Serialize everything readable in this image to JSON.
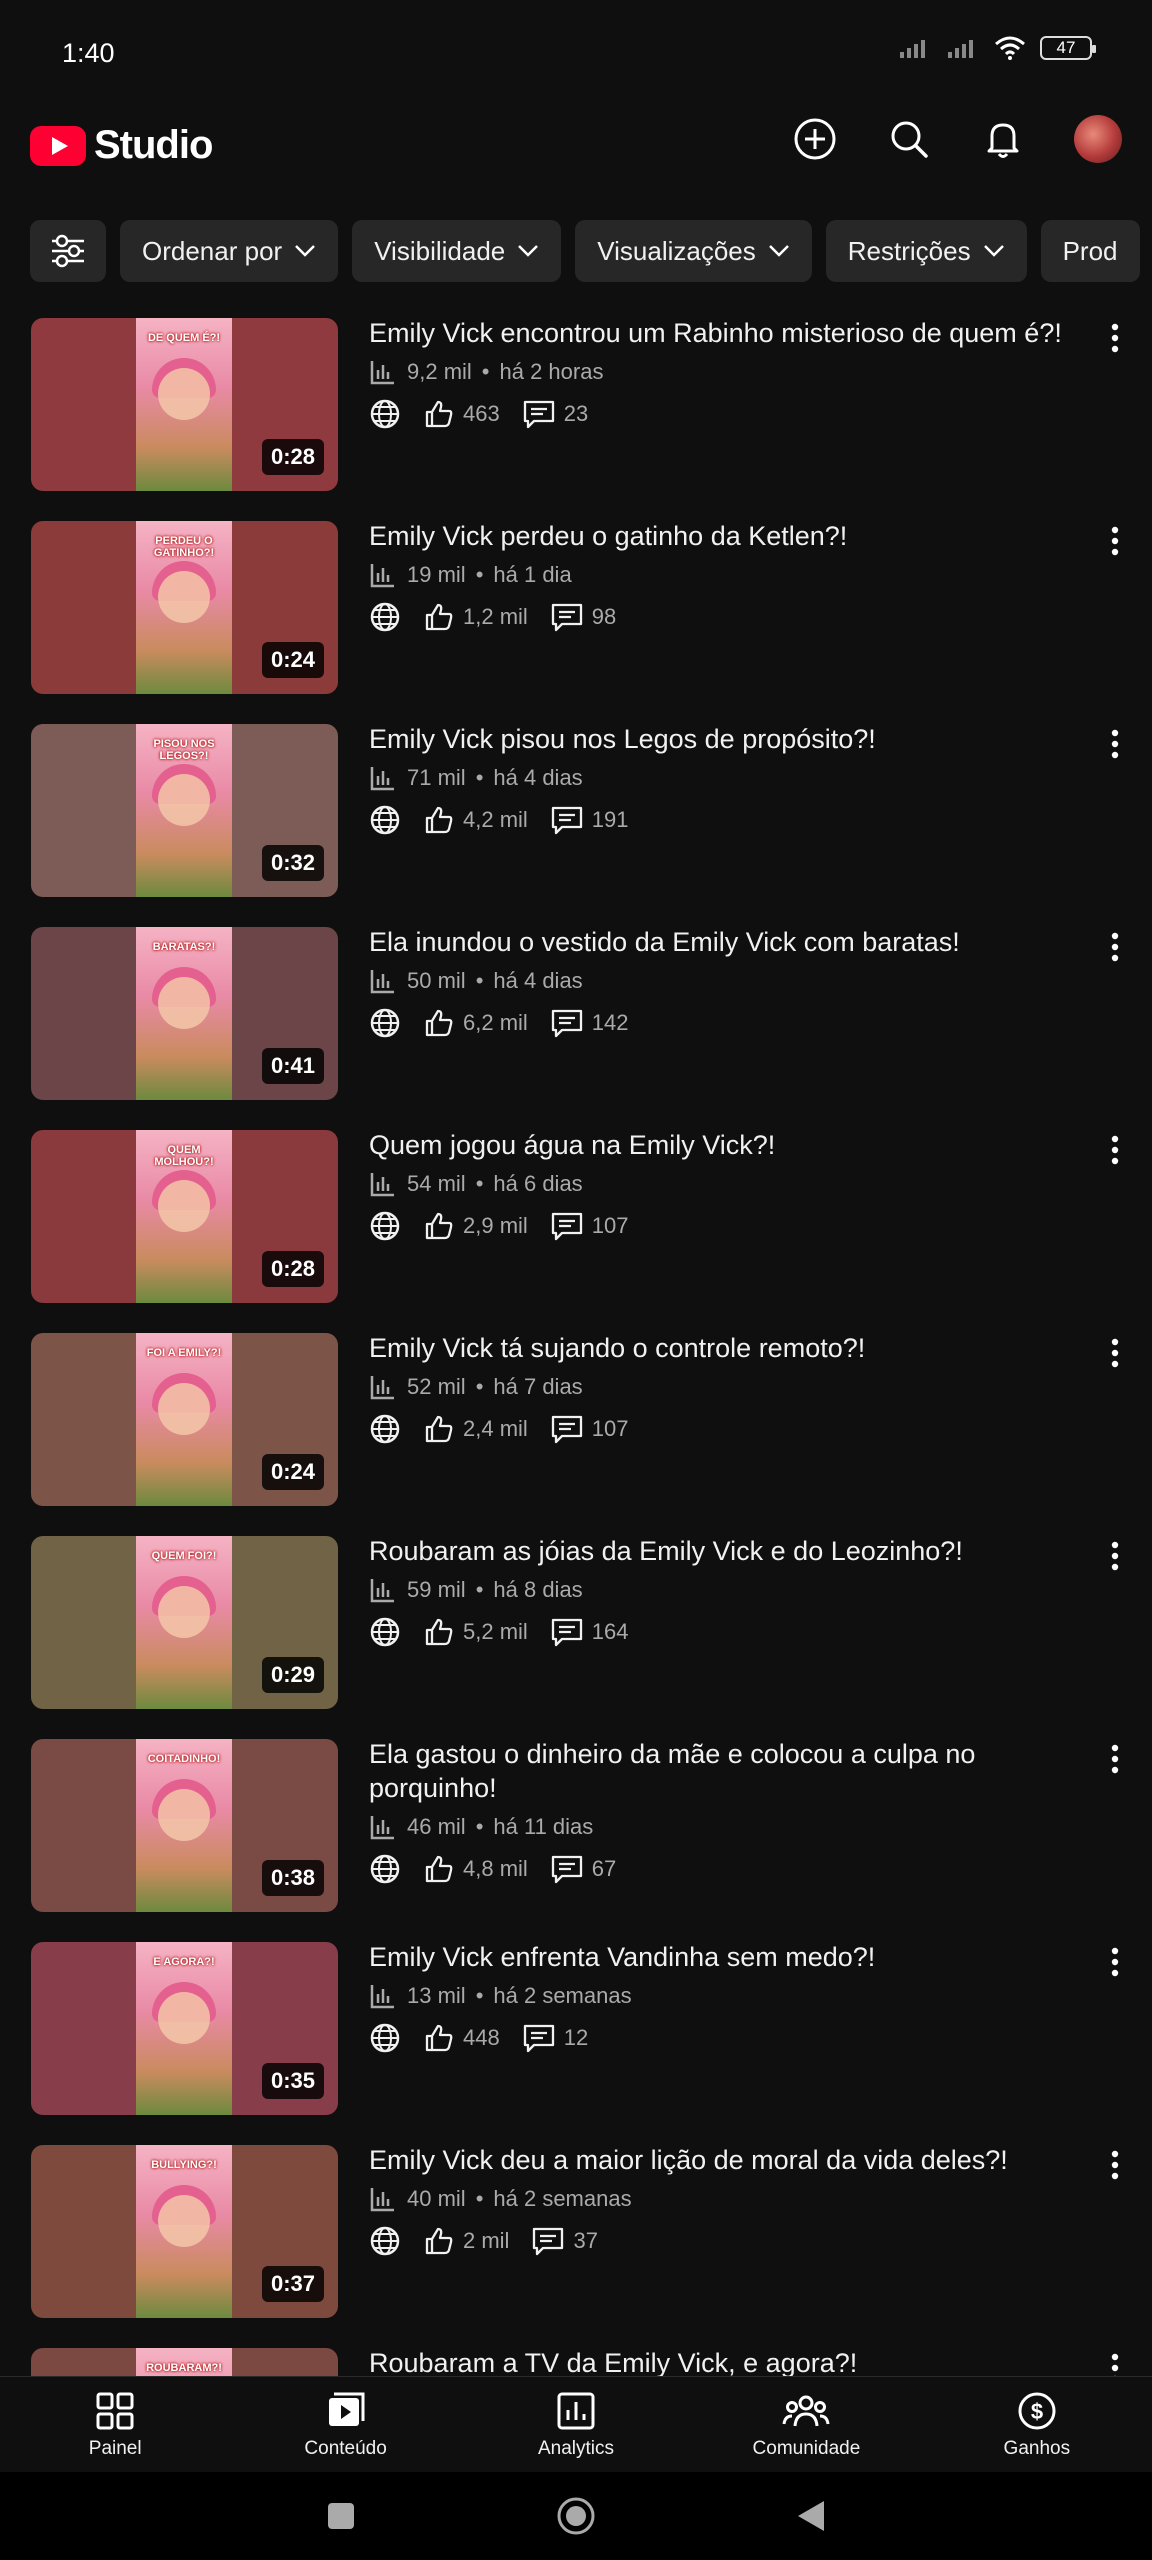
{
  "status_bar": {
    "time": "1:40",
    "battery": "47"
  },
  "header": {
    "app_name": "Studio"
  },
  "filters": [
    {
      "label": "Ordenar por"
    },
    {
      "label": "Visibilidade"
    },
    {
      "label": "Visualizações"
    },
    {
      "label": "Restrições"
    },
    {
      "label": "Prod"
    }
  ],
  "videos": [
    {
      "title": "Emily Vick encontrou um Rabinho misterioso de quem é?!",
      "views": "9,2 mil",
      "age": "há 2 horas",
      "likes": "463",
      "comments": "23",
      "duration": "0:28",
      "thumb_text": "DE QUEM É?!",
      "thumb_color": "#8e3a3e"
    },
    {
      "title": "Emily Vick perdeu o gatinho da Ketlen?!",
      "views": "19 mil",
      "age": "há 1 dia",
      "likes": "1,2 mil",
      "comments": "98",
      "duration": "0:24",
      "thumb_text": "PERDEU O GATINHO?!",
      "thumb_color": "#8b3b3a"
    },
    {
      "title": "Emily Vick pisou nos Legos de propósito?!",
      "views": "71 mil",
      "age": "há 4 dias",
      "likes": "4,2 mil",
      "comments": "191",
      "duration": "0:32",
      "thumb_text": "PISOU NOS LEGOS?!",
      "thumb_color": "#7d5c57"
    },
    {
      "title": "Ela inundou o vestido da Emily Vick com baratas!",
      "views": "50 mil",
      "age": "há 4 dias",
      "likes": "6,2 mil",
      "comments": "142",
      "duration": "0:41",
      "thumb_text": "BARATAS?!",
      "thumb_color": "#6c4548"
    },
    {
      "title": "Quem jogou água na Emily Vick?!",
      "views": "54 mil",
      "age": "há 6 dias",
      "likes": "2,9 mil",
      "comments": "107",
      "duration": "0:28",
      "thumb_text": "QUEM MOLHOU?!",
      "thumb_color": "#8a3a3c"
    },
    {
      "title": "Emily Vick tá sujando o controle remoto?!",
      "views": "52 mil",
      "age": "há 7 dias",
      "likes": "2,4 mil",
      "comments": "107",
      "duration": "0:24",
      "thumb_text": "FOI A EMILY?!",
      "thumb_color": "#7d5548"
    },
    {
      "title": "Roubaram as jóias da Emily Vick e do Leozinho?!",
      "views": "59 mil",
      "age": "há 8 dias",
      "likes": "5,2 mil",
      "comments": "164",
      "duration": "0:29",
      "thumb_text": "QUEM FOI?!",
      "thumb_color": "#706346"
    },
    {
      "title": "Ela gastou o dinheiro da mãe e colocou a culpa no porquinho!",
      "views": "46 mil",
      "age": "há 11 dias",
      "likes": "4,8 mil",
      "comments": "67",
      "duration": "0:38",
      "thumb_text": "COITADINHO!",
      "thumb_color": "#7a4a45"
    },
    {
      "title": "Emily Vick enfrenta Vandinha sem medo?!",
      "views": "13 mil",
      "age": "há 2 semanas",
      "likes": "448",
      "comments": "12",
      "duration": "0:35",
      "thumb_text": "E AGORA?!",
      "thumb_color": "#883e4a"
    },
    {
      "title": "Emily Vick deu a maior lição de moral da vida deles?!",
      "views": "40 mil",
      "age": "há 2 semanas",
      "likes": "2 mil",
      "comments": "37",
      "duration": "0:37",
      "thumb_text": "BULLYING?!",
      "thumb_color": "#7f4a3e"
    },
    {
      "title": "Roubaram a TV da Emily Vick, e agora?!",
      "views": "",
      "age": "",
      "likes": "",
      "comments": "",
      "duration": "",
      "thumb_text": "ROUBARAM?!",
      "thumb_color": "#7c4842"
    }
  ],
  "bottom_nav": [
    {
      "label": "Painel",
      "icon": "dashboard-icon"
    },
    {
      "label": "Conteúdo",
      "icon": "content-icon"
    },
    {
      "label": "Analytics",
      "icon": "analytics-icon"
    },
    {
      "label": "Comunidade",
      "icon": "community-icon"
    },
    {
      "label": "Ganhos",
      "icon": "earnings-icon"
    }
  ]
}
